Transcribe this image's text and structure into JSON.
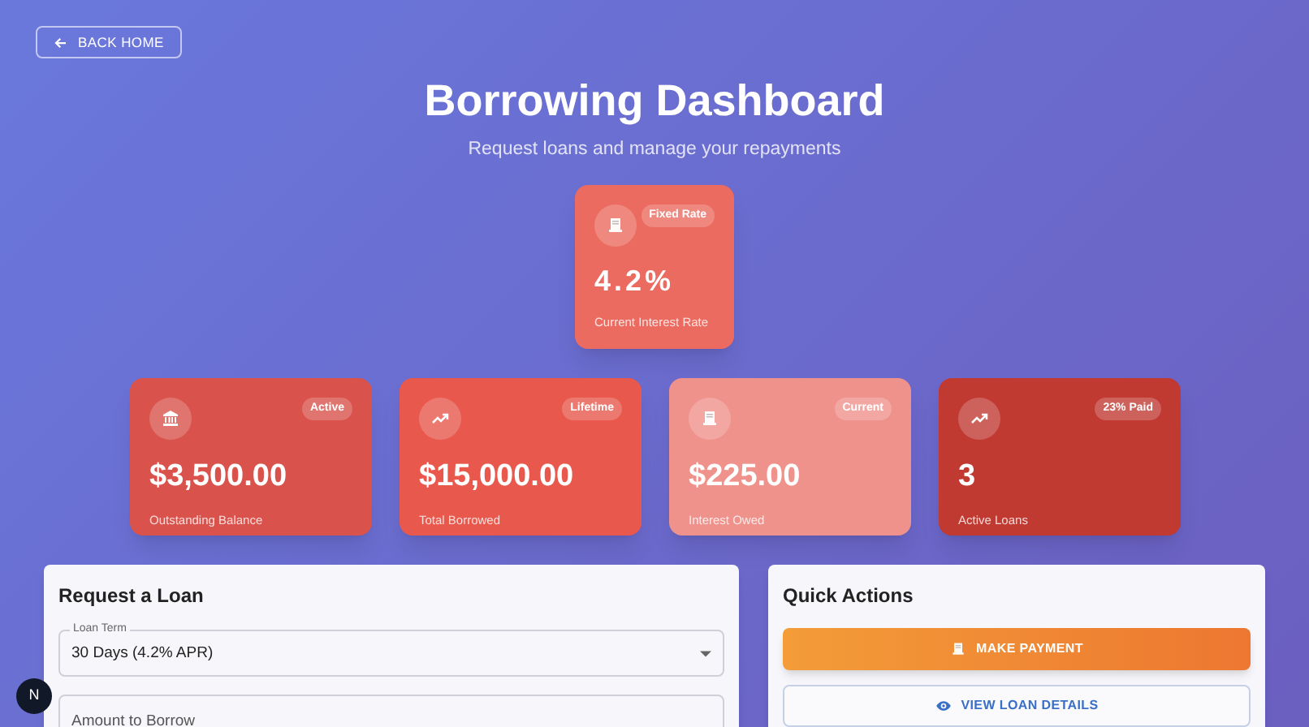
{
  "back_button": {
    "label": "BACK HOME"
  },
  "header": {
    "title": "Borrowing Dashboard",
    "subtitle": "Request loans and manage your repayments"
  },
  "rate_card": {
    "kind": "receipt",
    "badge": "Fixed Rate",
    "value": "4.2%",
    "label": "Current Interest Rate",
    "color": "#ec6b60"
  },
  "stat_cards": [
    {
      "kind": "bank",
      "badge": "Active",
      "value": "$3,500.00",
      "label": "Outstanding Balance",
      "color": "#d9524b"
    },
    {
      "kind": "trend",
      "badge": "Lifetime",
      "value": "$15,000.00",
      "label": "Total Borrowed",
      "color": "#e8584c"
    },
    {
      "kind": "receipt",
      "badge": "Current",
      "value": "$225.00",
      "label": "Interest Owed",
      "color": "#ef928c"
    },
    {
      "kind": "trend",
      "badge": "23% Paid",
      "value": "3",
      "label": "Active Loans",
      "color": "#c13a32"
    }
  ],
  "request_panel": {
    "title": "Request a Loan",
    "fields": [
      {
        "kind": "select",
        "label": "Loan Term",
        "value": "30 Days (4.2% APR)"
      },
      {
        "kind": "input",
        "placeholder": "Amount to Borrow"
      }
    ]
  },
  "quick_actions": {
    "title": "Quick Actions",
    "buttons": [
      {
        "kind": "primary",
        "label": "MAKE PAYMENT"
      },
      {
        "kind": "outline",
        "label": "VIEW LOAN DETAILS"
      }
    ]
  },
  "dev_badge": {
    "label": "N"
  }
}
